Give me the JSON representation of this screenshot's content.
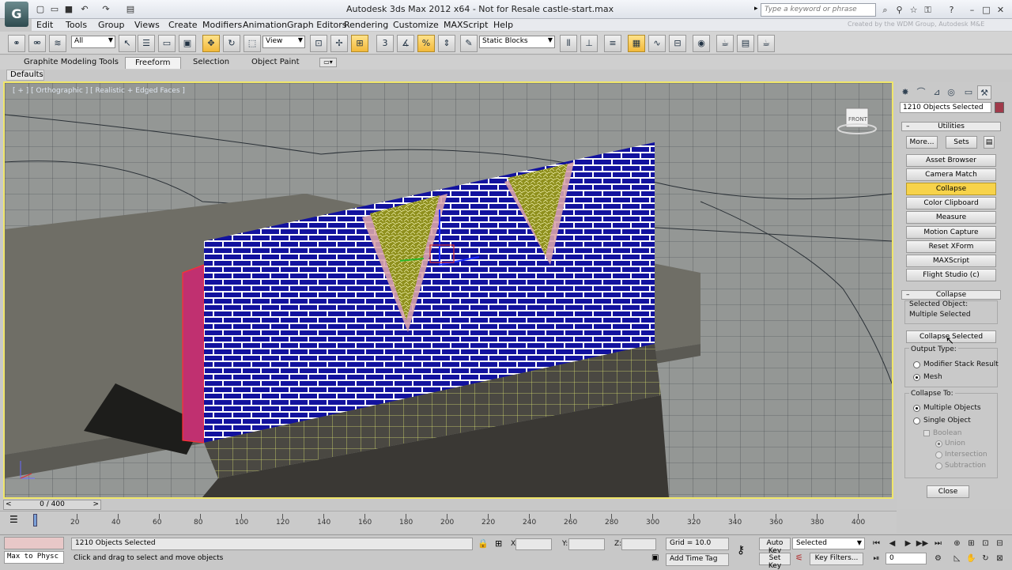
{
  "window": {
    "title": "Autodesk 3ds Max  2012 x64    -  Not for Resale    castle-start.max",
    "logo_text": "G",
    "search_placeholder": "Type a keyword or phrase",
    "watermark": "Created by the WDM Group, Autodesk M&E"
  },
  "menu": [
    "Edit",
    "Tools",
    "Group",
    "Views",
    "Create",
    "Modifiers",
    "Animation",
    "Graph Editors",
    "Rendering",
    "Customize",
    "MAXScript",
    "Help"
  ],
  "toolbar": {
    "selection_filter": "All",
    "ref_coord": "View",
    "named_selection": "Static Blocks"
  },
  "ribbon": {
    "tabs": [
      "Graphite Modeling Tools",
      "Freeform",
      "Selection",
      "Object Paint"
    ],
    "active_tab": "Freeform",
    "defaults_label": "Defaults"
  },
  "viewport": {
    "label": "[ + ] [ Orthographic ] [ Realistic + Edged Faces ]",
    "viewcube_text": "FRONT"
  },
  "panel": {
    "selection_count": "1210 Objects Selected",
    "utilities_title": "Utilities",
    "more_label": "More...",
    "sets_label": "Sets",
    "utility_buttons": [
      "Asset Browser",
      "Camera Match",
      "Collapse",
      "Color Clipboard",
      "Measure",
      "Motion Capture",
      "Reset XForm",
      "MAXScript",
      "Flight Studio (c)"
    ],
    "active_utility": "Collapse",
    "collapse_title": "Collapse",
    "selected_object_label": "Selected Object:",
    "selected_object_value": "Multiple Selected",
    "collapse_selected": "Collapse Selected",
    "output_type_label": "Output Type:",
    "output_modifier": "Modifier Stack Result",
    "output_mesh": "Mesh",
    "collapse_to_label": "Collapse To:",
    "collapse_multiple": "Multiple Objects",
    "collapse_single": "Single Object",
    "boolean_label": "Boolean",
    "union_label": "Union",
    "intersection_label": "Intersection",
    "subtraction_label": "Subtraction",
    "close_label": "Close"
  },
  "timeline": {
    "frame_display": "0 / 400",
    "ticks": [
      "20",
      "40",
      "60",
      "80",
      "100",
      "120",
      "140",
      "160",
      "180",
      "200",
      "220",
      "240",
      "260",
      "280",
      "300",
      "320",
      "340",
      "360",
      "380",
      "400"
    ]
  },
  "status": {
    "maxscript_listener": "Max to Physc",
    "selection_info": "1210 Objects Selected",
    "prompt": "Click and drag to select and move objects",
    "x_label": "X:",
    "y_label": "Y:",
    "z_label": "Z:",
    "grid": "Grid = 10.0",
    "add_time_tag": "Add Time Tag",
    "auto_key": "Auto Key",
    "set_key": "Set Key",
    "key_mode": "Selected",
    "key_filters": "Key Filters...",
    "current_frame": "0"
  }
}
